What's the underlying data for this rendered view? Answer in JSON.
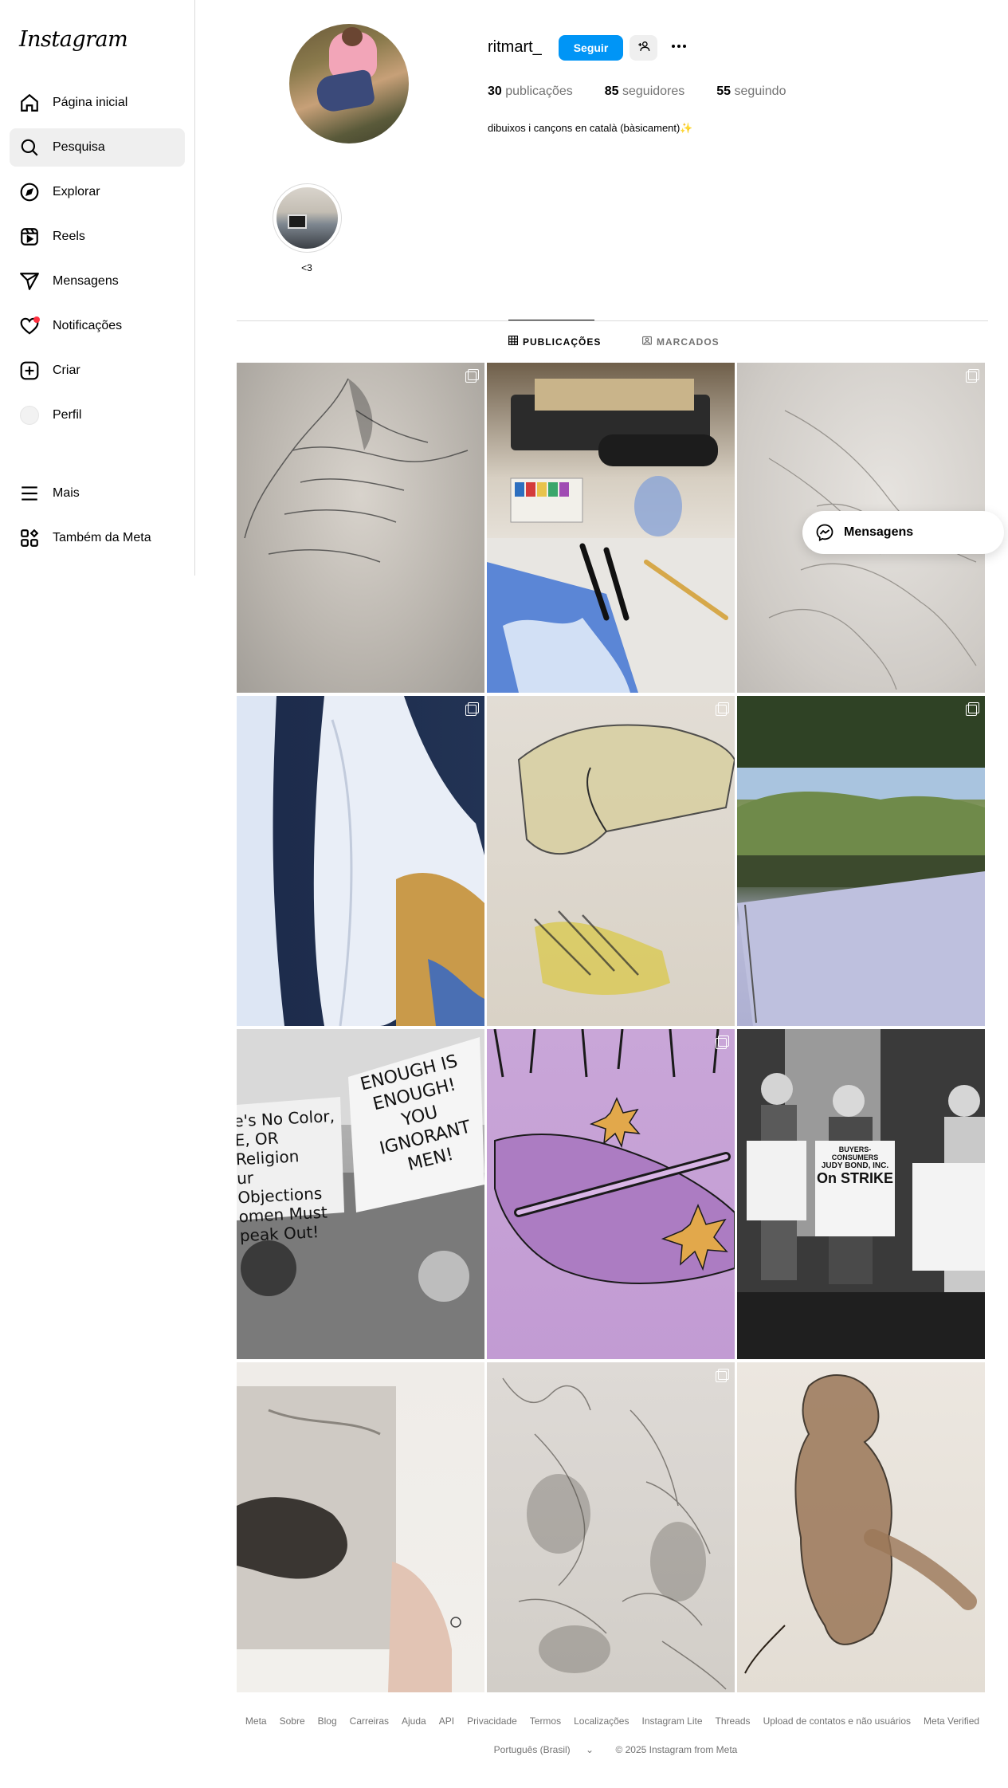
{
  "app": {
    "logo_text": "Instagram"
  },
  "sidebar": {
    "items": [
      {
        "label": "Página inicial",
        "icon": "home-icon"
      },
      {
        "label": "Pesquisa",
        "icon": "search-icon"
      },
      {
        "label": "Explorar",
        "icon": "compass-icon"
      },
      {
        "label": "Reels",
        "icon": "reels-icon"
      },
      {
        "label": "Mensagens",
        "icon": "send-icon"
      },
      {
        "label": "Notificações",
        "icon": "heart-icon"
      },
      {
        "label": "Criar",
        "icon": "plus-square-icon"
      },
      {
        "label": "Perfil",
        "icon": "avatar-icon"
      }
    ],
    "bottom_items": [
      {
        "label": "Mais",
        "icon": "menu-icon"
      },
      {
        "label": "Também da Meta",
        "icon": "meta-apps-icon"
      }
    ]
  },
  "profile": {
    "username": "ritmart_",
    "follow_label": "Seguir",
    "stats": {
      "posts_count": "30",
      "posts_label": "publicações",
      "followers_count": "85",
      "followers_label": "seguidores",
      "following_count": "55",
      "following_label": "seguindo"
    },
    "bio": "dibuixos i cançons en català (bàsicament)✨"
  },
  "highlight": {
    "label": "<3"
  },
  "tabs": {
    "posts": "PUBLICAÇÕES",
    "tagged": "MARCADOS"
  },
  "posts": [
    {
      "subject": "pencil drawing of a hand",
      "multi": true
    },
    {
      "subject": "art supplies on a desk",
      "multi": false
    },
    {
      "subject": "pencil sketch of hands",
      "multi": true
    },
    {
      "subject": "white sneakers",
      "multi": true
    },
    {
      "subject": "colored drawing of hands",
      "multi": true
    },
    {
      "subject": "sketchbook in a landscape",
      "multi": true
    },
    {
      "subject": "protest photo with signs",
      "multi": false
    },
    {
      "subject": "purple illustration with flowers",
      "multi": true
    },
    {
      "subject": "women on strike with signs",
      "multi": false
    },
    {
      "subject": "printed t-shirt",
      "multi": false
    },
    {
      "subject": "graphite hand studies",
      "multi": true
    },
    {
      "subject": "ink figure drawing",
      "multi": false
    }
  ],
  "protest_signs": {
    "left": [
      "e's No Color,",
      "E, OR Religion",
      "ur Objections",
      "omen Must",
      "peak Out!"
    ],
    "right": [
      "ENOUGH IS",
      "ENOUGH!",
      "YOU IGNORANT",
      "MEN!"
    ]
  },
  "strike_signs": {
    "header": "BUYERS-CONSUMERS",
    "company": "JUDY BOND, INC.",
    "status": "On STRIKE"
  },
  "floating_chat": {
    "label": "Mensagens"
  },
  "footer": {
    "links": [
      "Meta",
      "Sobre",
      "Blog",
      "Carreiras",
      "Ajuda",
      "API",
      "Privacidade",
      "Termos",
      "Localizações",
      "Instagram Lite",
      "Threads",
      "Upload de contatos e não usuários",
      "Meta Verified"
    ],
    "language": "Português (Brasil)",
    "copyright": "© 2025 Instagram from Meta"
  },
  "colors": {
    "accent": "#0095f6",
    "notification_dot": "#ff3040",
    "muted_text": "#737373"
  }
}
